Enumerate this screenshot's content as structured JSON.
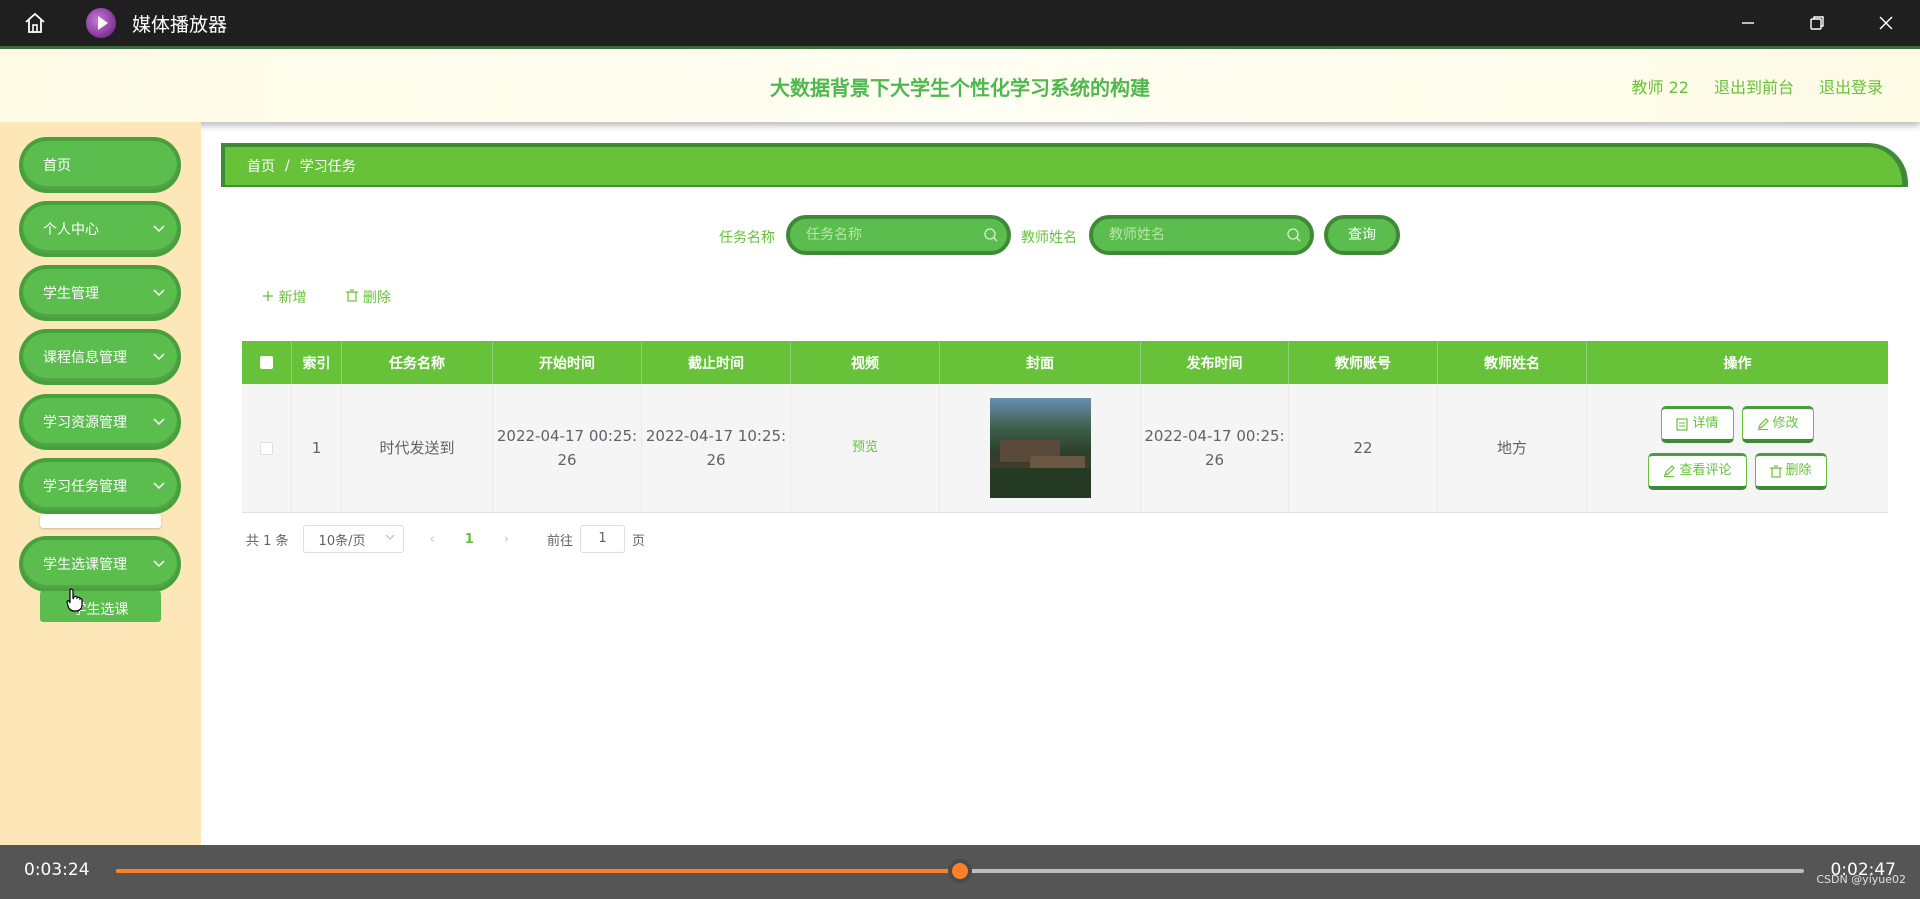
{
  "player": {
    "title": "媒体播放器",
    "current_time": "0:03:24",
    "remaining_time": "0:02:47",
    "progress": 0.5,
    "watermark": "CSDN @yiyue02",
    "accent": "#ff7f27"
  },
  "header": {
    "title": "大数据背景下大学生个性化学习系统的构建",
    "user": "教师 22",
    "back_front": "退出到前台",
    "logout": "退出登录"
  },
  "sidebar": {
    "items": [
      {
        "label": "首页"
      },
      {
        "label": "个人中心"
      },
      {
        "label": "学生管理"
      },
      {
        "label": "课程信息管理"
      },
      {
        "label": "学习资源管理"
      },
      {
        "label": "学习任务管理"
      },
      {
        "label": "学生选课管理"
      }
    ],
    "submenu_label": "学生选课"
  },
  "breadcrumb": {
    "home": "首页",
    "sep": "/",
    "current": "学习任务"
  },
  "search": {
    "task_name_label": "任务名称",
    "task_name_placeholder": "任务名称",
    "teacher_name_label": "教师姓名",
    "teacher_name_placeholder": "教师姓名",
    "query_button": "查询"
  },
  "actions": {
    "add": "新增",
    "delete": "删除"
  },
  "table": {
    "columns": [
      "索引",
      "任务名称",
      "开始时间",
      "截止时间",
      "视频",
      "封面",
      "发布时间",
      "教师账号",
      "教师姓名",
      "操作"
    ],
    "rows": [
      {
        "index": "1",
        "task_name": "时代发送到",
        "start_line1": "2022-04-17 00:25:",
        "start_line2": "26",
        "end_line1": "2022-04-17 10:25:",
        "end_line2": "26",
        "video": "预览",
        "publish_line1": "2022-04-17 00:25:",
        "publish_line2": "26",
        "teacher_account": "22",
        "teacher_name": "地方",
        "ops": {
          "detail": "详情",
          "edit": "修改",
          "comments": "查看评论",
          "delete": "删除"
        }
      }
    ]
  },
  "pagination": {
    "total": "共 1 条",
    "page_size": "10条/页",
    "current_page": "1",
    "goto_prefix": "前往",
    "goto_value": "1",
    "goto_suffix": "页"
  },
  "colors": {
    "primary": "#67c23a",
    "sidebar_bg": "#fde7b8",
    "header_bg": "#fdfbe6"
  }
}
